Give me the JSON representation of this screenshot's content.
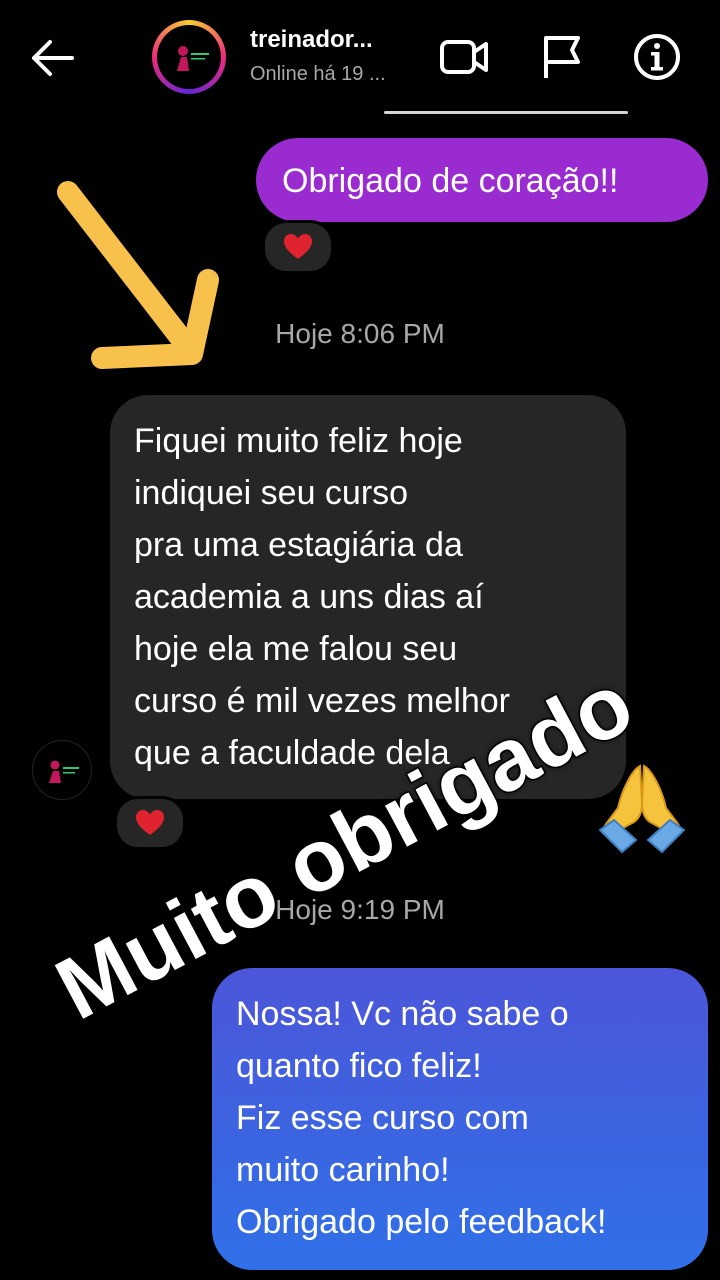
{
  "header": {
    "contact_name": "treinador...",
    "status": "Online há 19 ...",
    "icons": [
      "back-arrow-icon",
      "video-call-icon",
      "flag-icon",
      "info-icon"
    ]
  },
  "messages": [
    {
      "direction": "outgoing",
      "lines": [
        "Obrigado de coração!!"
      ],
      "reaction": "heart"
    },
    {
      "timestamp": "Hoje 8:06 PM"
    },
    {
      "direction": "incoming",
      "lines": [
        "Fiquei muito feliz hoje",
        "indiquei seu curso",
        "pra uma estagiária da",
        "academia a uns dias aí",
        "hoje ela me falou seu",
        "curso é mil vezes melhor",
        "que a faculdade dela"
      ],
      "reaction": "heart"
    },
    {
      "timestamp": "Hoje 9:19 PM"
    },
    {
      "direction": "outgoing",
      "lines": [
        "Nossa! Vc não sabe o",
        "quanto fico feliz!",
        "Fiz esse curso com",
        "muito carinho!",
        "Obrigado pelo feedback!"
      ]
    }
  ],
  "overlay": {
    "caption": "Muito obrigado",
    "emoji": "praying-hands",
    "arrow_color": "#f7c14b"
  },
  "colors": {
    "outgoing_purple": "#9a2bd1",
    "outgoing_blue": "#2f70e8",
    "incoming_bg": "#262626",
    "heart": "#e0242f"
  }
}
